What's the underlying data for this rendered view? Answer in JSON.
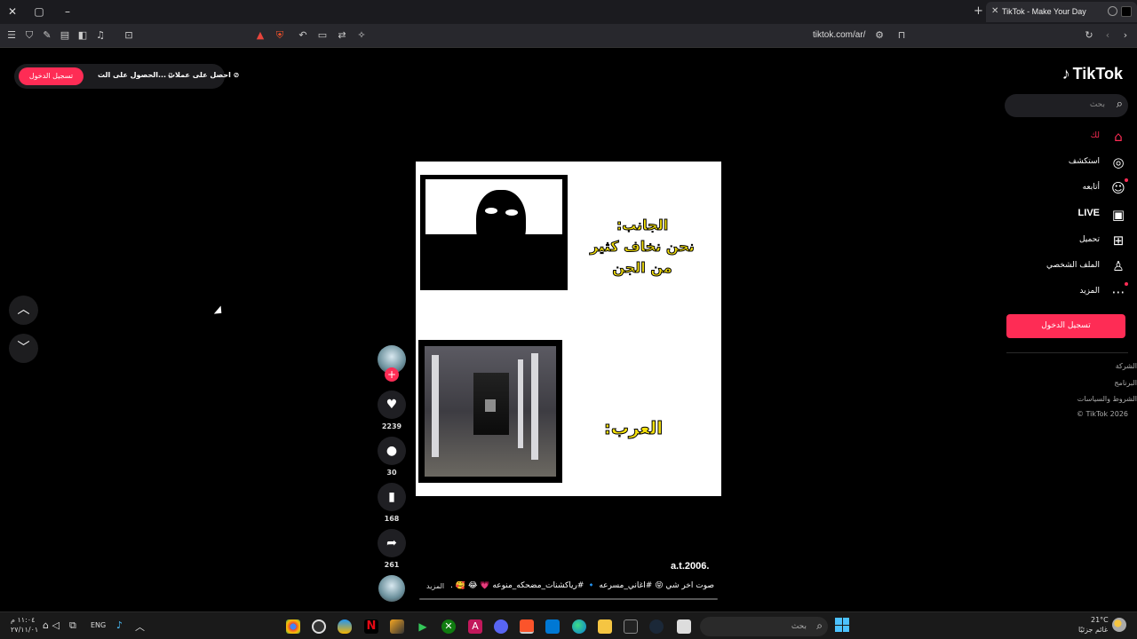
{
  "browser": {
    "tab_title": "TikTok - Make Your Day",
    "url": "tiktok.com/ar/",
    "new_tab": "+",
    "close": "✕"
  },
  "tiktok": {
    "logo": "TikTok",
    "search_placeholder": "بحث",
    "nav": [
      {
        "label": "لك",
        "icon": "home-icon",
        "glyph": "⌂"
      },
      {
        "label": "استكشف",
        "icon": "compass-icon",
        "glyph": "◎"
      },
      {
        "label": "أتابعه",
        "icon": "following-icon",
        "glyph": "☺"
      },
      {
        "label": "LIVE",
        "icon": "live-icon",
        "glyph": "▣"
      },
      {
        "label": "تحميل",
        "icon": "upload-icon",
        "glyph": "⊞"
      },
      {
        "label": "الملف الشخصي",
        "icon": "profile-icon",
        "glyph": "♙"
      },
      {
        "label": "المزيد",
        "icon": "more-icon",
        "glyph": "⋯"
      }
    ],
    "login_button": "تسجيل الدخول",
    "footer": [
      "الشركة",
      "البرنامج",
      "الشروط والسياسات",
      "© TikTok 2026"
    ],
    "top_pill": {
      "login": "تسجيل الدخول",
      "get_app": "الحصول على الت...",
      "get_coins": "احصل على عملات"
    },
    "video": {
      "text_top": [
        "الجانب:",
        "نحن نخاف كثير",
        "من الجن"
      ],
      "text_bottom": "العرب:"
    },
    "actions": {
      "likes": "2239",
      "comments": "30",
      "saves": "168",
      "shares": "261"
    },
    "username": "a.t.2006.",
    "caption": "صوت اخر شي 😝 #اغاني_مسرعه 🔹 #رياكشنات_مضحكه_منوعه 💗 😂 🥰 ...",
    "more": "المزيد"
  },
  "taskbar": {
    "time": "١١:٠٤ م",
    "date": "٢٧/١١/٠١",
    "lang": "ENG",
    "search": "بحث",
    "weather_temp": "21°C",
    "weather_desc": "غائم جزئيًا"
  }
}
